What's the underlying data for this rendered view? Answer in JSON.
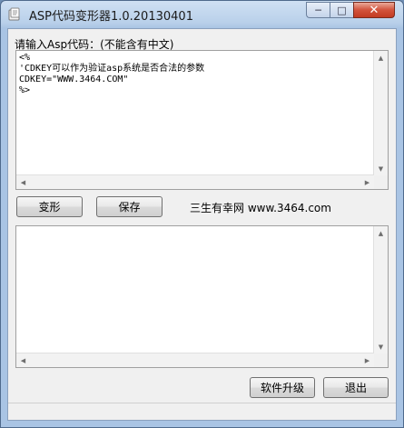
{
  "window": {
    "title": "ASP代码变形器1.0.20130401",
    "controls": {
      "minimize": "─",
      "maximize": "□",
      "close": "✕"
    }
  },
  "input": {
    "label": "请输入Asp代码：(不能含有中文)",
    "code": "<%\n'CDKEY可以作为验证asp系统是否合法的参数\nCDKEY=\"WWW.3464.COM\"\n%>"
  },
  "toolbar": {
    "transform_label": "变形",
    "save_label": "保存",
    "site_text": "三生有幸网 www.3464.com"
  },
  "output": {
    "code": ""
  },
  "footer": {
    "upgrade_label": "软件升级",
    "exit_label": "退出"
  }
}
